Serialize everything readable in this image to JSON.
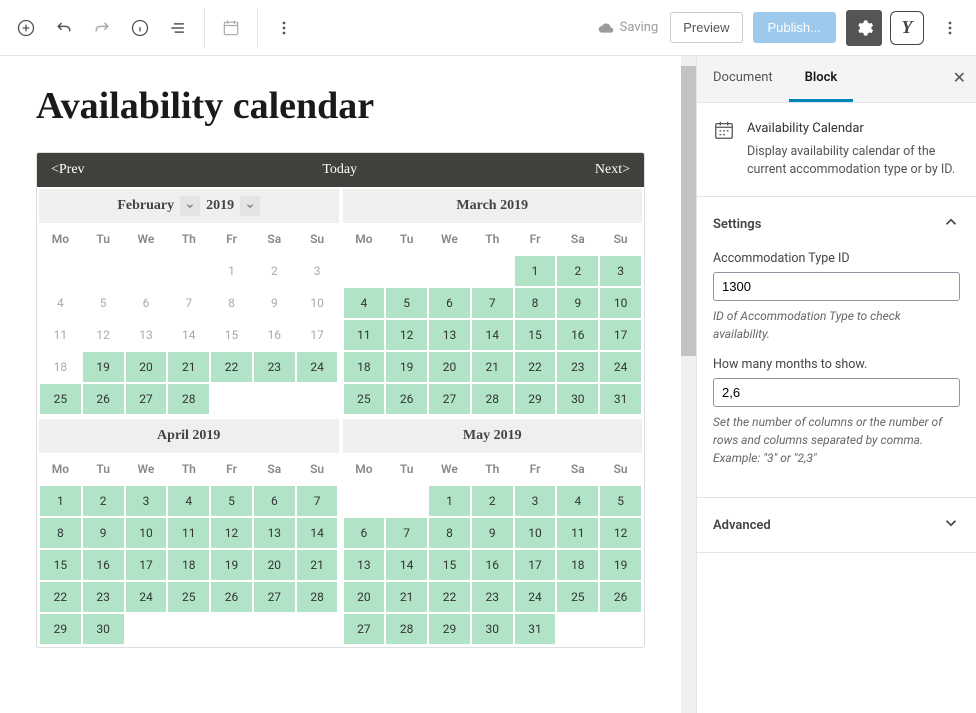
{
  "topbar": {
    "saving": "Saving",
    "preview": "Preview",
    "publish": "Publish...",
    "yoast": "Y"
  },
  "post": {
    "title": "Availability calendar"
  },
  "calendar": {
    "prev": "<Prev",
    "today": "Today",
    "next": "Next>",
    "dows": [
      "Mo",
      "Tu",
      "We",
      "Th",
      "Fr",
      "Sa",
      "Su"
    ],
    "months": [
      {
        "label": "February",
        "year": "2019",
        "selectable": true,
        "weeks": [
          [
            null,
            null,
            null,
            null,
            {
              "n": "1",
              "a": false
            },
            {
              "n": "2",
              "a": false
            },
            {
              "n": "3",
              "a": false
            }
          ],
          [
            {
              "n": "4",
              "a": false
            },
            {
              "n": "5",
              "a": false
            },
            {
              "n": "6",
              "a": false
            },
            {
              "n": "7",
              "a": false
            },
            {
              "n": "8",
              "a": false
            },
            {
              "n": "9",
              "a": false
            },
            {
              "n": "10",
              "a": false
            }
          ],
          [
            {
              "n": "11",
              "a": false
            },
            {
              "n": "12",
              "a": false
            },
            {
              "n": "13",
              "a": false
            },
            {
              "n": "14",
              "a": false
            },
            {
              "n": "15",
              "a": false
            },
            {
              "n": "16",
              "a": false
            },
            {
              "n": "17",
              "a": false
            }
          ],
          [
            {
              "n": "18",
              "a": false
            },
            {
              "n": "19",
              "a": true
            },
            {
              "n": "20",
              "a": true
            },
            {
              "n": "21",
              "a": true
            },
            {
              "n": "22",
              "a": true
            },
            {
              "n": "23",
              "a": true
            },
            {
              "n": "24",
              "a": true
            }
          ],
          [
            {
              "n": "25",
              "a": true
            },
            {
              "n": "26",
              "a": true
            },
            {
              "n": "27",
              "a": true
            },
            {
              "n": "28",
              "a": true
            },
            null,
            null,
            null
          ]
        ]
      },
      {
        "label": "March 2019",
        "selectable": false,
        "weeks": [
          [
            null,
            null,
            null,
            null,
            {
              "n": "1",
              "a": true
            },
            {
              "n": "2",
              "a": true
            },
            {
              "n": "3",
              "a": true
            }
          ],
          [
            {
              "n": "4",
              "a": true
            },
            {
              "n": "5",
              "a": true
            },
            {
              "n": "6",
              "a": true
            },
            {
              "n": "7",
              "a": true
            },
            {
              "n": "8",
              "a": true
            },
            {
              "n": "9",
              "a": true
            },
            {
              "n": "10",
              "a": true
            }
          ],
          [
            {
              "n": "11",
              "a": true
            },
            {
              "n": "12",
              "a": true
            },
            {
              "n": "13",
              "a": true
            },
            {
              "n": "14",
              "a": true
            },
            {
              "n": "15",
              "a": true
            },
            {
              "n": "16",
              "a": true
            },
            {
              "n": "17",
              "a": true
            }
          ],
          [
            {
              "n": "18",
              "a": true
            },
            {
              "n": "19",
              "a": true
            },
            {
              "n": "20",
              "a": true
            },
            {
              "n": "21",
              "a": true
            },
            {
              "n": "22",
              "a": true
            },
            {
              "n": "23",
              "a": true
            },
            {
              "n": "24",
              "a": true
            }
          ],
          [
            {
              "n": "25",
              "a": true
            },
            {
              "n": "26",
              "a": true
            },
            {
              "n": "27",
              "a": true
            },
            {
              "n": "28",
              "a": true
            },
            {
              "n": "29",
              "a": true
            },
            {
              "n": "30",
              "a": true
            },
            {
              "n": "31",
              "a": true
            }
          ]
        ]
      },
      {
        "label": "April 2019",
        "selectable": false,
        "weeks": [
          [
            {
              "n": "1",
              "a": true
            },
            {
              "n": "2",
              "a": true
            },
            {
              "n": "3",
              "a": true
            },
            {
              "n": "4",
              "a": true
            },
            {
              "n": "5",
              "a": true
            },
            {
              "n": "6",
              "a": true
            },
            {
              "n": "7",
              "a": true
            }
          ],
          [
            {
              "n": "8",
              "a": true
            },
            {
              "n": "9",
              "a": true
            },
            {
              "n": "10",
              "a": true
            },
            {
              "n": "11",
              "a": true
            },
            {
              "n": "12",
              "a": true
            },
            {
              "n": "13",
              "a": true
            },
            {
              "n": "14",
              "a": true
            }
          ],
          [
            {
              "n": "15",
              "a": true
            },
            {
              "n": "16",
              "a": true
            },
            {
              "n": "17",
              "a": true
            },
            {
              "n": "18",
              "a": true
            },
            {
              "n": "19",
              "a": true
            },
            {
              "n": "20",
              "a": true
            },
            {
              "n": "21",
              "a": true
            }
          ],
          [
            {
              "n": "22",
              "a": true
            },
            {
              "n": "23",
              "a": true
            },
            {
              "n": "24",
              "a": true
            },
            {
              "n": "25",
              "a": true
            },
            {
              "n": "26",
              "a": true
            },
            {
              "n": "27",
              "a": true
            },
            {
              "n": "28",
              "a": true
            }
          ],
          [
            {
              "n": "29",
              "a": true
            },
            {
              "n": "30",
              "a": true
            },
            null,
            null,
            null,
            null,
            null
          ]
        ]
      },
      {
        "label": "May 2019",
        "selectable": false,
        "weeks": [
          [
            null,
            null,
            {
              "n": "1",
              "a": true
            },
            {
              "n": "2",
              "a": true
            },
            {
              "n": "3",
              "a": true
            },
            {
              "n": "4",
              "a": true
            },
            {
              "n": "5",
              "a": true
            }
          ],
          [
            {
              "n": "6",
              "a": true
            },
            {
              "n": "7",
              "a": true
            },
            {
              "n": "8",
              "a": true
            },
            {
              "n": "9",
              "a": true
            },
            {
              "n": "10",
              "a": true
            },
            {
              "n": "11",
              "a": true
            },
            {
              "n": "12",
              "a": true
            }
          ],
          [
            {
              "n": "13",
              "a": true
            },
            {
              "n": "14",
              "a": true
            },
            {
              "n": "15",
              "a": true
            },
            {
              "n": "16",
              "a": true
            },
            {
              "n": "17",
              "a": true
            },
            {
              "n": "18",
              "a": true
            },
            {
              "n": "19",
              "a": true
            }
          ],
          [
            {
              "n": "20",
              "a": true
            },
            {
              "n": "21",
              "a": true
            },
            {
              "n": "22",
              "a": true
            },
            {
              "n": "23",
              "a": true
            },
            {
              "n": "24",
              "a": true
            },
            {
              "n": "25",
              "a": true
            },
            {
              "n": "26",
              "a": true
            }
          ],
          [
            {
              "n": "27",
              "a": true
            },
            {
              "n": "28",
              "a": true
            },
            {
              "n": "29",
              "a": true
            },
            {
              "n": "30",
              "a": true
            },
            {
              "n": "31",
              "a": true
            },
            null,
            null
          ]
        ]
      }
    ]
  },
  "sidebar": {
    "tab_document": "Document",
    "tab_block": "Block",
    "block_title": "Availability Calendar",
    "block_desc": "Display availability calendar of the current accommodation type or by ID.",
    "panel_settings": "Settings",
    "panel_advanced": "Advanced",
    "type_id_label": "Accommodation Type ID",
    "type_id_value": "1300",
    "type_id_help": "ID of Accommodation Type to check availability.",
    "months_label": "How many months to show.",
    "months_value": "2,6",
    "months_help": "Set the number of columns or the number of rows and columns separated by comma. Example: \"3\" or \"2,3\""
  }
}
